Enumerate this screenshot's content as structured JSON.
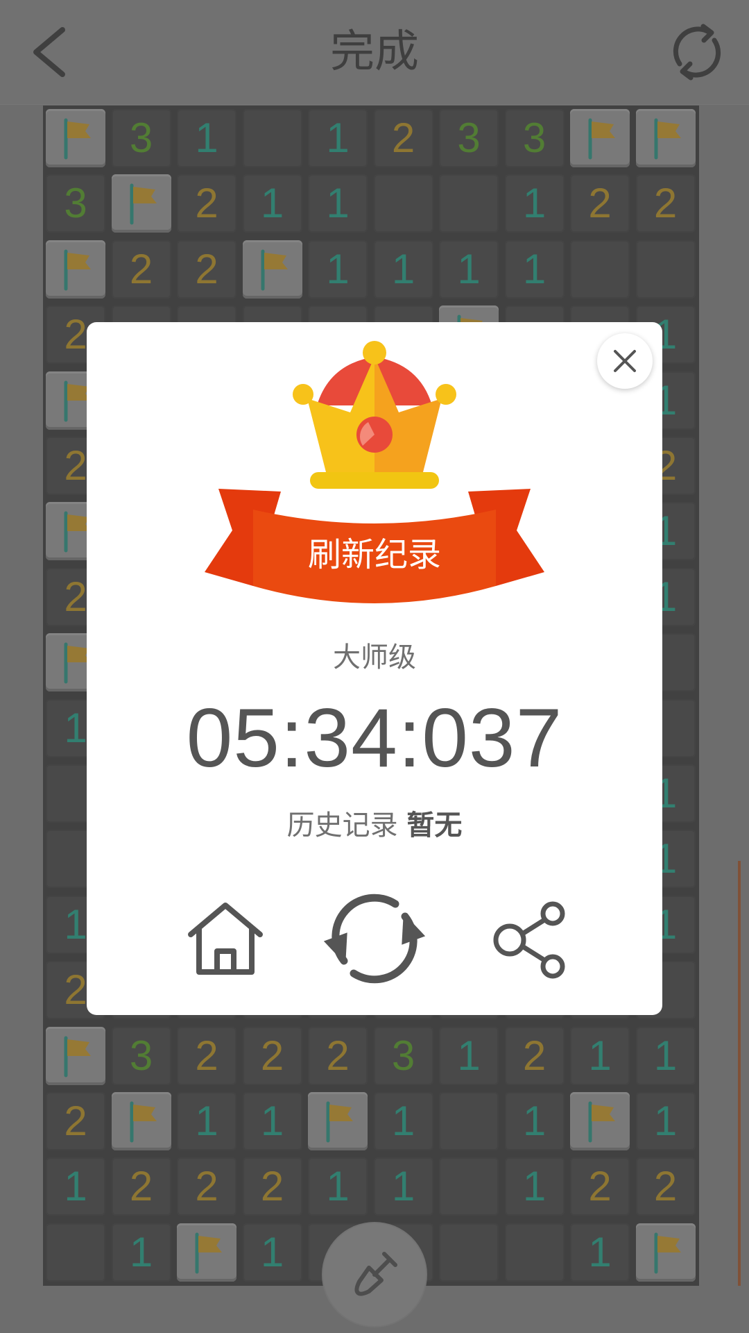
{
  "header": {
    "title": "完成",
    "back_icon": "chevron-left-icon",
    "refresh_icon": "refresh-icon"
  },
  "board": {
    "rows": [
      [
        "F",
        "3",
        "1",
        "",
        "1",
        "2",
        "3",
        "3",
        "F",
        "F"
      ],
      [
        "3",
        "F",
        "2",
        "1",
        "1",
        "",
        "",
        "1",
        "2",
        "2"
      ],
      [
        "F",
        "2",
        "2",
        "F",
        "1",
        "1",
        "1",
        "1",
        "",
        ""
      ],
      [
        "2",
        "",
        "",
        "",
        "",
        "",
        "F",
        "",
        "",
        "1"
      ],
      [
        "F",
        "",
        "",
        "",
        "",
        "",
        "",
        "",
        "",
        "1"
      ],
      [
        "2",
        "",
        "",
        "",
        "",
        "",
        "",
        "",
        "",
        "2"
      ],
      [
        "F",
        "",
        "",
        "",
        "",
        "",
        "",
        "",
        "",
        "1"
      ],
      [
        "2",
        "",
        "",
        "",
        "",
        "",
        "",
        "",
        "",
        "1"
      ],
      [
        "F",
        "",
        "",
        "",
        "",
        "",
        "",
        "",
        "",
        ""
      ],
      [
        "1",
        "",
        "",
        "",
        "",
        "",
        "",
        "",
        "",
        ""
      ],
      [
        "",
        "",
        "",
        "",
        "",
        "",
        "",
        "",
        "",
        "1"
      ],
      [
        "",
        "",
        "",
        "",
        "",
        "",
        "",
        "",
        "",
        "1"
      ],
      [
        "1",
        "",
        "",
        "",
        "",
        "",
        "",
        "",
        "",
        "1"
      ],
      [
        "2",
        "",
        "",
        "",
        "",
        "",
        "",
        "",
        "",
        ""
      ],
      [
        "F",
        "3",
        "2",
        "2",
        "2",
        "3",
        "1",
        "2",
        "1",
        "1"
      ],
      [
        "2",
        "F",
        "1",
        "1",
        "F",
        "1",
        "",
        "1",
        "F",
        "1"
      ],
      [
        "1",
        "2",
        "2",
        "2",
        "1",
        "1",
        "",
        "1",
        "2",
        "2"
      ],
      [
        "",
        "1",
        "F",
        "1",
        "",
        "",
        "",
        "",
        "1",
        "F"
      ]
    ],
    "number_colors": {
      "1": "#159a80",
      "2": "#b48b16",
      "3": "#4d9619"
    },
    "flag_icon": "flag-icon"
  },
  "dialog": {
    "ribbon_text": "刷新纪录",
    "level": "大师级",
    "time": "05:34:037",
    "history_label": "历史记录",
    "history_value": "暂无",
    "close_icon": "close-icon",
    "home_icon": "home-icon",
    "replay_icon": "replay-icon",
    "share_icon": "share-icon",
    "crown_icon": "crown-icon"
  },
  "bottom": {
    "shovel_icon": "shovel-icon"
  },
  "colors": {
    "ribbon": "#ea4a10",
    "crown_gold": "#f7c21a",
    "crown_red": "#e84a3a",
    "text_dark": "#555555"
  }
}
